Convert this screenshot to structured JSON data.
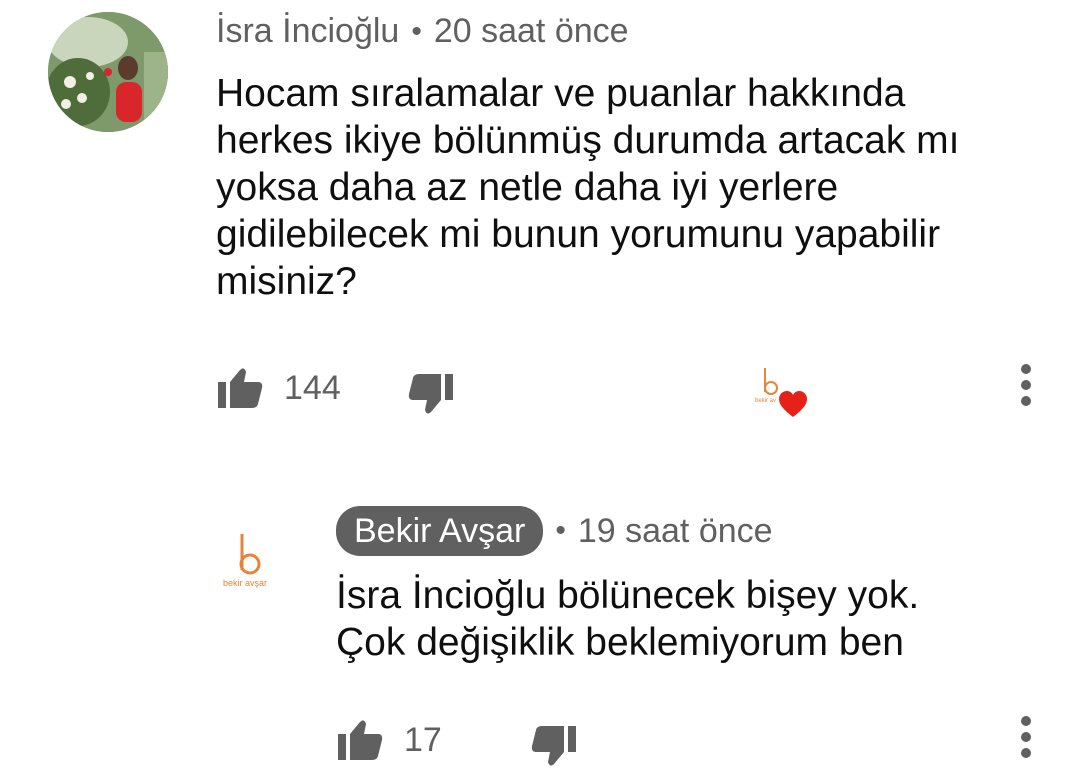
{
  "comment": {
    "author": "İsra İncioğlu",
    "separator": "•",
    "time": "20 saat önce",
    "lines": [
      "Hocam sıralamalar ve puanlar hakkında",
      "herkes ikiye bölünmüş durumda artacak mı",
      "yoksa daha az netle daha iyi yerlere",
      "gidilebilecek mi bunun yorumunu yapabilir",
      "misiniz?"
    ],
    "likes": "144",
    "heart_badge_logo_text": "bekir av"
  },
  "reply": {
    "author": "Bekir Avşar",
    "separator": "•",
    "time": "19 saat önce",
    "lines": [
      "İsra İncioğlu bölünecek bişey yok.",
      "Çok değişiklik beklemiyorum ben"
    ],
    "likes": "17",
    "avatar_logo_letter": "b",
    "avatar_logo_text": "bekir avşar"
  },
  "colors": {
    "meta_gray": "#606060",
    "brand_orange": "#e8833a",
    "heart_red": "#e62117"
  }
}
